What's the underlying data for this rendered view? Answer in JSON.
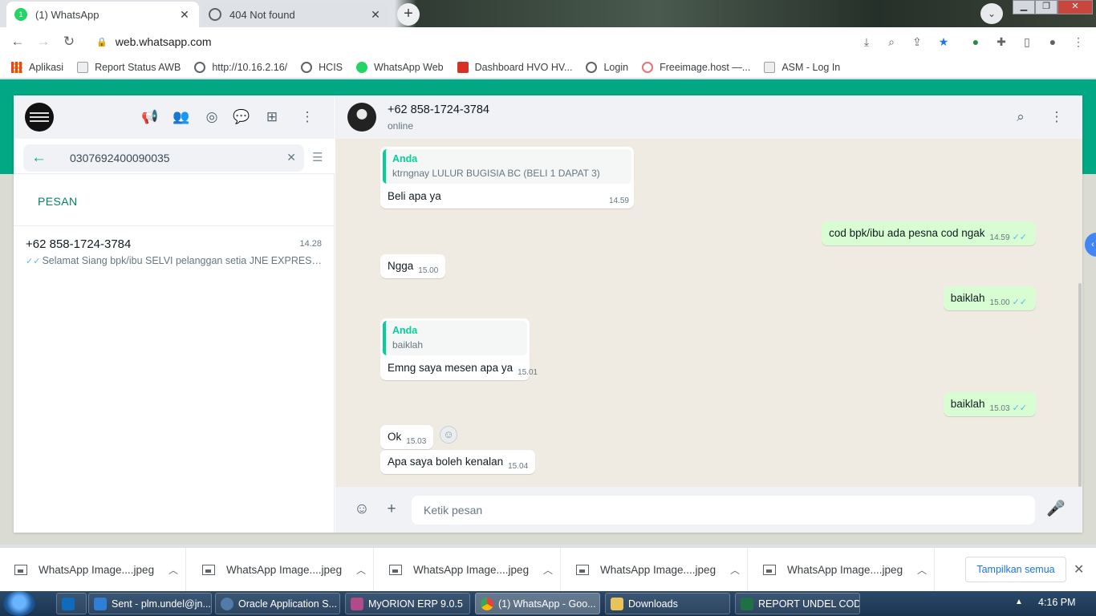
{
  "browser": {
    "tabs": [
      {
        "title": "(1) WhatsApp",
        "active": true
      },
      {
        "title": "404 Not found",
        "active": false
      }
    ],
    "url": "web.whatsapp.com",
    "bookmarks": [
      {
        "label": "Aplikasi",
        "icon": "apps-grid-icon"
      },
      {
        "label": "Report Status AWB",
        "icon": "page-icon"
      },
      {
        "label": "http://10.16.2.16/",
        "icon": "globe-icon"
      },
      {
        "label": "HCIS",
        "icon": "globe-icon"
      },
      {
        "label": "WhatsApp Web",
        "icon": "whatsapp-icon"
      },
      {
        "label": "Dashboard HVO HV...",
        "icon": "dashboard-icon"
      },
      {
        "label": "Login",
        "icon": "globe-icon"
      },
      {
        "label": "Freeimage.host —...",
        "icon": "freeimage-icon"
      },
      {
        "label": "ASM - Log In",
        "icon": "page-icon"
      }
    ]
  },
  "sidebar": {
    "search_value": "0307692400090035",
    "section_label": "PESAN",
    "chat": {
      "name": "+62 858-1724-3784",
      "time": "14.28",
      "preview": "Selamat Siang   bpk/ibu SELVI pelanggan setia JNE EXPRESS,..."
    }
  },
  "conversation": {
    "contact_name": "+62 858-1724-3784",
    "contact_status": "online",
    "messages": [
      {
        "direction": "in",
        "quote_author": "Anda",
        "quote_text": "ktrngnay LULUR BUGISIA BC (BELI 1 DAPAT 3)",
        "text": "Beli apa ya",
        "time": "14.59"
      },
      {
        "direction": "out",
        "text": "cod bpk/ibu ada pesna cod ngak",
        "time": "14.59"
      },
      {
        "direction": "in",
        "text": "Ngga",
        "time": "15.00"
      },
      {
        "direction": "out",
        "text": "baiklah",
        "time": "15.00"
      },
      {
        "direction": "in",
        "quote_author": "Anda",
        "quote_text": "baiklah",
        "text": "Emng saya mesen apa ya",
        "time": "15.01"
      },
      {
        "direction": "out",
        "text": "baiklah",
        "time": "15.03"
      },
      {
        "direction": "in",
        "text": "Ok",
        "time": "15.03"
      },
      {
        "direction": "in",
        "text": "Apa saya boleh kenalan",
        "time": "15.04"
      }
    ],
    "composer_placeholder": "Ketik pesan"
  },
  "downloads": {
    "items": [
      {
        "name": "WhatsApp Image....jpeg"
      },
      {
        "name": "WhatsApp Image....jpeg"
      },
      {
        "name": "WhatsApp Image....jpeg"
      },
      {
        "name": "WhatsApp Image....jpeg"
      },
      {
        "name": "WhatsApp Image....jpeg"
      }
    ],
    "show_all": "Tampilkan semua"
  },
  "taskbar": {
    "items": [
      {
        "label": "Sent - plm.undel@jn...",
        "icon": "outlook-icon"
      },
      {
        "label": "Oracle Application S...",
        "icon": "oracle-icon"
      },
      {
        "label": "MyORION ERP 9.0.5",
        "icon": "orion-icon"
      },
      {
        "label": "(1) WhatsApp - Goo...",
        "icon": "chrome-icon"
      },
      {
        "label": "Downloads",
        "icon": "folder-icon"
      },
      {
        "label": "REPORT UNDEL COD...",
        "icon": "excel-icon"
      }
    ],
    "clock": "4:16 PM"
  },
  "colors": {
    "whatsapp_green": "#00a884",
    "outgoing_bubble": "#d9fdd3",
    "chat_background": "#efeae2",
    "read_ticks": "#53bdeb"
  }
}
